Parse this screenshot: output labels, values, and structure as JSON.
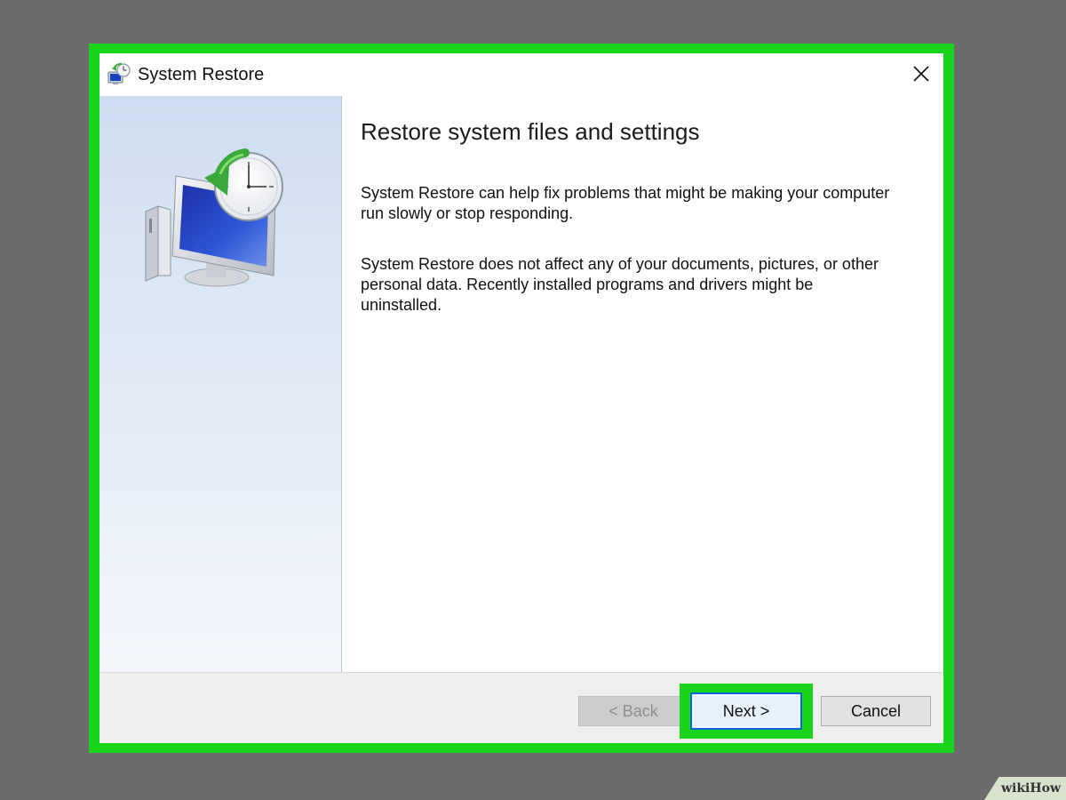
{
  "window": {
    "title": "System Restore",
    "icon": "system-restore-icon",
    "close_icon": "close-icon"
  },
  "side_panel": {
    "illustration": "system-restore-illustration",
    "gradient_top": "#cfdcf1",
    "gradient_bottom": "#f3f6fb"
  },
  "content": {
    "heading": "Restore system files and settings",
    "paragraph_1": "System Restore can help fix problems that might be making your computer run slowly or stop responding.",
    "paragraph_2": "System Restore does not affect any of your documents, pictures, or other personal data. Recently installed programs and drivers might be uninstalled."
  },
  "footer": {
    "back_label": "< Back",
    "back_enabled": false,
    "next_label": "Next >",
    "cancel_label": "Cancel"
  },
  "highlight": {
    "color": "#1ad41c",
    "target": "next-button"
  },
  "watermark": {
    "text": "wikiHow"
  }
}
